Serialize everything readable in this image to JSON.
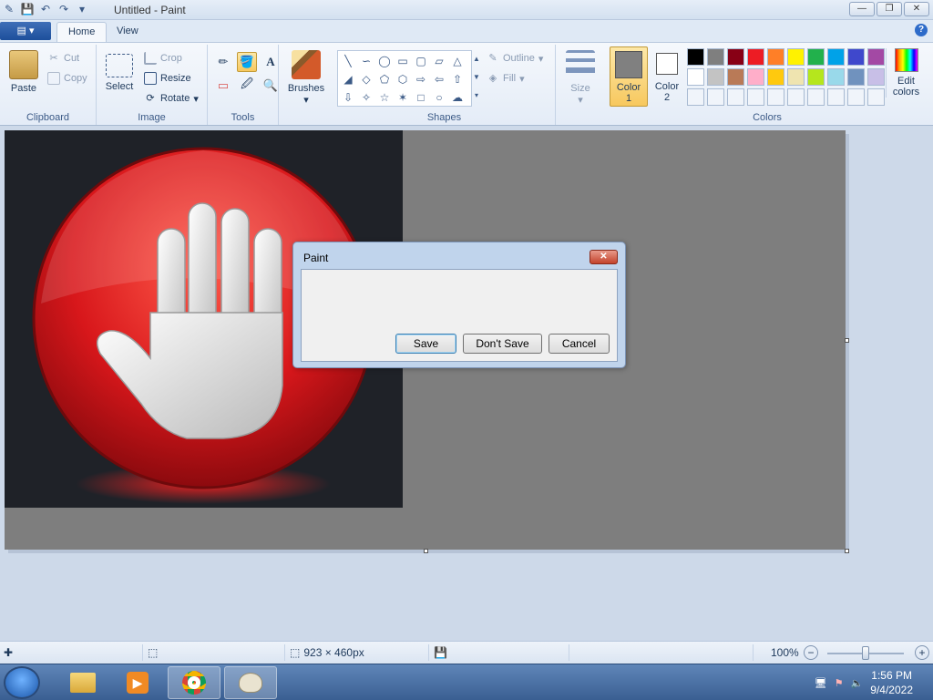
{
  "window": {
    "title": "Untitled - Paint"
  },
  "titlebar": {
    "qat_icons": [
      "paint-app-icon",
      "save-icon",
      "undo-icon",
      "redo-icon",
      "customize-qat-icon"
    ]
  },
  "tabs": {
    "app_menu": "▤ ▾",
    "home": "Home",
    "view": "View"
  },
  "ribbon": {
    "clipboard": {
      "label": "Clipboard",
      "paste": "Paste",
      "cut": "Cut",
      "copy": "Copy"
    },
    "image": {
      "label": "Image",
      "select": "Select",
      "crop": "Crop",
      "resize": "Resize",
      "rotate": "Rotate"
    },
    "tools": {
      "label": "Tools",
      "selected_tool": "fill-bucket"
    },
    "brushes": {
      "label": "Brushes"
    },
    "shapes": {
      "label": "Shapes",
      "outline": "Outline",
      "fill": "Fill"
    },
    "size": {
      "label": "Size"
    },
    "color1": {
      "line1": "Color",
      "line2": "1",
      "value": "#808080"
    },
    "color2": {
      "line1": "Color",
      "line2": "2",
      "value": "#ffffff"
    },
    "colors": {
      "label": "Colors",
      "edit_line1": "Edit",
      "edit_line2": "colors",
      "palette_row1": [
        "#000000",
        "#7f7f7f",
        "#880015",
        "#ed1c24",
        "#ff7f27",
        "#fff200",
        "#22b14c",
        "#00a2e8",
        "#3f48cc",
        "#a349a4"
      ],
      "palette_row2": [
        "#ffffff",
        "#c3c3c3",
        "#b97a57",
        "#ffaec9",
        "#ffc90e",
        "#efe4b0",
        "#b5e61d",
        "#99d9ea",
        "#7092be",
        "#c8bfe7"
      ]
    }
  },
  "canvas": {
    "background": "#7e7e7e",
    "text_line1": "",
    "text_line2": ""
  },
  "dialog": {
    "title": "Paint",
    "close": "✕",
    "save": "Save",
    "dont_save": "Don't Save",
    "cancel": "Cancel"
  },
  "statusbar": {
    "image_size": "923 × 460px",
    "zoom": "100%",
    "zoom_level_percent": 100
  },
  "taskbar": {
    "apps": [
      "file-explorer-icon",
      "media-player-icon",
      "chrome-icon",
      "paint-icon"
    ],
    "time": "1:56 PM",
    "date": "9/4/2022"
  }
}
